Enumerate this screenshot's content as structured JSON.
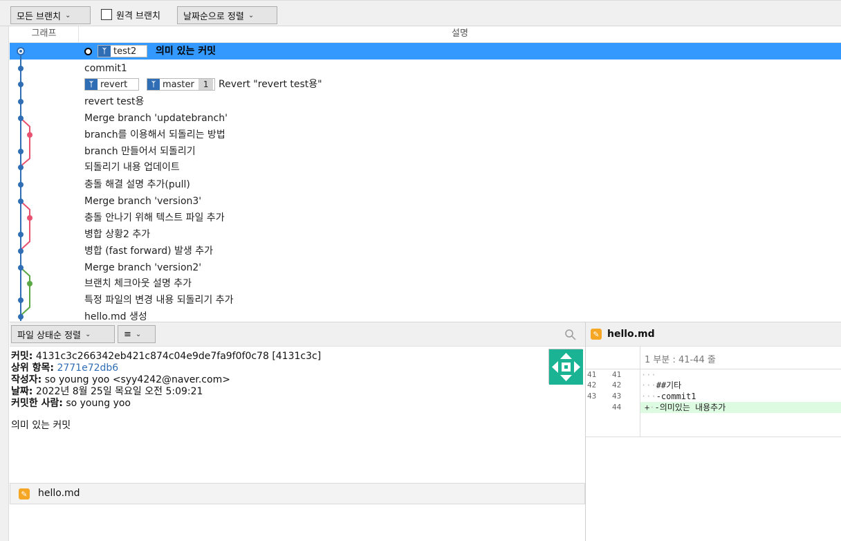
{
  "toolbar": {
    "branch_filter": "모든 브랜치",
    "remote_branches_label": "원격 브랜치",
    "sort_order": "날짜순으로 정렬"
  },
  "columns": {
    "graph": "그래프",
    "description": "설명"
  },
  "commits": [
    {
      "message": "의미 있는 커밋",
      "selected": true,
      "branches": [
        "test2"
      ]
    },
    {
      "message": "commit1"
    },
    {
      "message": "Revert \"revert test용\"",
      "branches": [
        "revert",
        "master"
      ],
      "ahead": "1"
    },
    {
      "message": "revert test용"
    },
    {
      "message": "Merge branch 'updatebranch'"
    },
    {
      "message": "branch를 이용해서 되돌리는 방법"
    },
    {
      "message": "branch 만들어서 되돌리기"
    },
    {
      "message": "되돌리기 내용 업데이트"
    },
    {
      "message": "충돌 해결 설명 추가(pull)"
    },
    {
      "message": "Merge branch 'version3'"
    },
    {
      "message": "충돌 안나기 위해 텍스트 파일 추가"
    },
    {
      "message": "병합 상황2 추가"
    },
    {
      "message": "병합 (fast forward) 발생 추가"
    },
    {
      "message": "Merge branch 'version2'"
    },
    {
      "message": "브랜치 체크아웃 설명 추가"
    },
    {
      "message": "특정 파일의 변경 내용 되돌리기 추가"
    },
    {
      "message": "hello.md 생성"
    }
  ],
  "graph_colors": {
    "main": "#2f6db5",
    "branch_red": "#e8526e",
    "branch_green": "#5aa845"
  },
  "file_panel": {
    "sort_label": "파일 상태순 정렬",
    "view_icon": "list-icon",
    "search_icon": "search-icon"
  },
  "commit_details": {
    "commit_label": "커밋:",
    "commit_hash": "4131c3c266342eb421c874c04e9de7fa9f0f0c78 [4131c3c]",
    "parent_label": "상위 항목:",
    "parent_hash": "2771e72db6",
    "author_label": "작성자:",
    "author": "so young yoo <syy4242@naver.com>",
    "date_label": "날짜:",
    "date": "2022년 8월 25일 목요일 오전 5:09:21",
    "committer_label": "커밋한 사람:",
    "committer": "so young yoo",
    "message": "의미 있는 커밋"
  },
  "changed_files": [
    {
      "name": "hello.md",
      "icon": "pencil-icon"
    }
  ],
  "file_list_header": "hello.md",
  "diff": {
    "file_name": "hello.md",
    "hunk_header": "1 부분 : 41-44 줄",
    "lines": [
      {
        "old": "41",
        "new": "41",
        "marker": "",
        "prefix": "···",
        "text": ""
      },
      {
        "old": "42",
        "new": "42",
        "marker": "",
        "prefix": "···",
        "text": "##기타"
      },
      {
        "old": "43",
        "new": "43",
        "marker": "",
        "prefix": "···",
        "text": "-commit1"
      },
      {
        "old": "",
        "new": "44",
        "marker": "+",
        "prefix": "·",
        "text": "-의미있는 내용추가",
        "added": true
      }
    ]
  }
}
